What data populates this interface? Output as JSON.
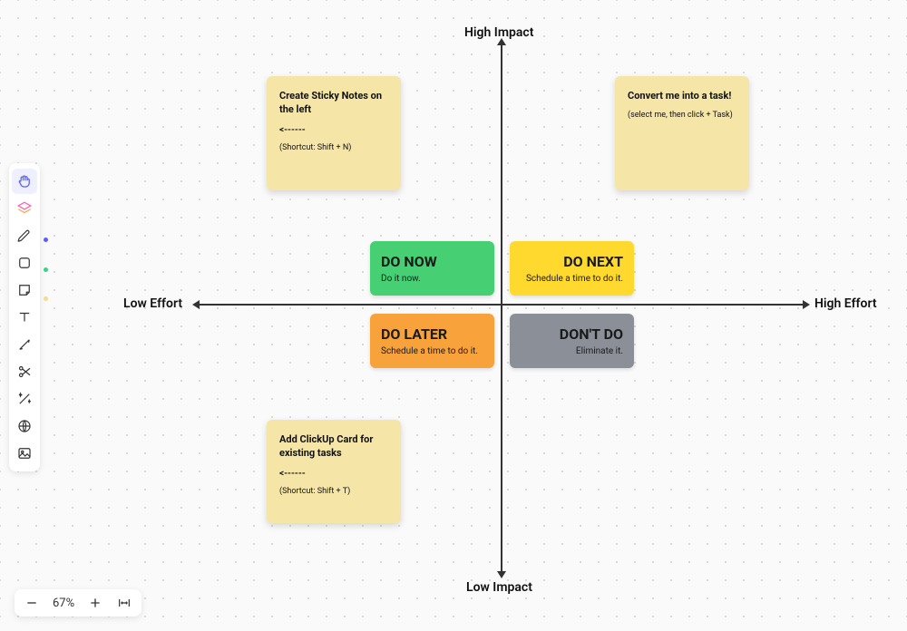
{
  "axes": {
    "top": "High Impact",
    "bottom": "Low Impact",
    "left": "Low Effort",
    "right": "High Effort"
  },
  "quadrants": {
    "do_now": {
      "title": "DO NOW",
      "sub": "Do it now.",
      "color": "#47cf73"
    },
    "do_next": {
      "title": "DO NEXT",
      "sub": "Schedule a time to do it.",
      "color": "#ffd92e"
    },
    "do_later": {
      "title": "DO LATER",
      "sub": "Schedule a time to do it.",
      "color": "#f7a23b"
    },
    "dont_do": {
      "title": "DON'T DO",
      "sub": "Eliminate it.",
      "color": "#8a8f98"
    }
  },
  "stickies": {
    "note1": {
      "title": "Create Sticky Notes on the left",
      "arrow": "<------",
      "hint": "(Shortcut: Shift + N)"
    },
    "note2": {
      "title": "Convert me into a task!",
      "hint": "(select me, then click + Task)"
    },
    "note3": {
      "title": "Add ClickUp Card for existing tasks",
      "arrow": "<------",
      "hint": "(Shortcut: Shift + T)"
    }
  },
  "zoom": {
    "level": "67%"
  },
  "toolbar_color_dots": {
    "pen": "#5b5fff",
    "shape": "#3ad18a",
    "sticky": "#f1dd8a"
  }
}
